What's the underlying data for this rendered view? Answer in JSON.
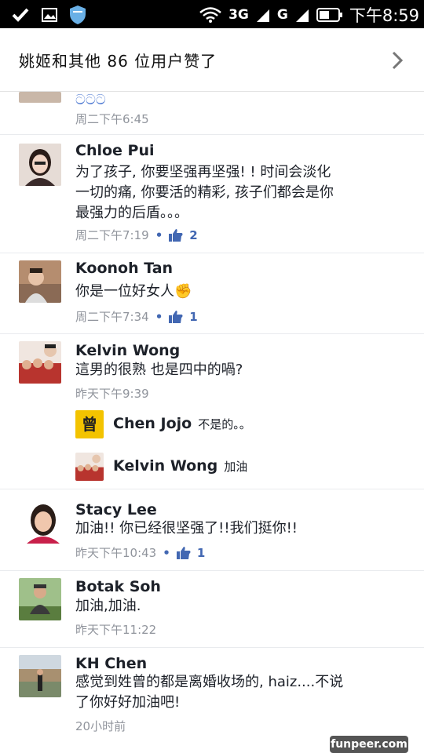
{
  "status_bar": {
    "network_3g": "3G",
    "network_g": "G",
    "time": "下午8:59"
  },
  "likes_header": {
    "text": "姚姬和其他 86 位用户赞了"
  },
  "partial_comment": {
    "emoji": "ටටට",
    "time": "周二下午6:45"
  },
  "comments": [
    {
      "name": "Chloe Pui",
      "lines": [
        "为了孩子, 你要坚强再坚强! ! 时间会淡化",
        "一切的痛, 你要活的精彩, 孩子们都会是你",
        "最强力的后盾。。。"
      ],
      "time": "周二下午7:19",
      "likes": "2"
    },
    {
      "name": "Koonoh Tan",
      "lines": [
        "你是一位好女人✊"
      ],
      "time": "周二下午7:34",
      "likes": "1"
    },
    {
      "name": "Kelvin Wong",
      "lines": [
        "這男的很熟 也是四中的喎?"
      ],
      "time": "昨天下午9:39"
    },
    {
      "name": "Stacy Lee",
      "lines": [
        "加油!! 你已经很坚强了!!我们挺你!!"
      ],
      "time": "昨天下午10:43",
      "likes": "1"
    },
    {
      "name": "Botak Soh",
      "lines": [
        "加油,加油."
      ],
      "time": "昨天下午11:22"
    },
    {
      "name": "KH Chen",
      "lines": [
        "感觉到姓曾的都是离婚收场的, haiz....不说",
        "了你好好加油吧!"
      ],
      "time": "20小时前"
    }
  ],
  "replies": [
    {
      "name": "Chen Jojo",
      "text": "不是的。。",
      "avatar_glyph": "曾"
    },
    {
      "name": "Kelvin Wong",
      "text": "加油"
    }
  ],
  "watermark": "funpeer.com",
  "colors": {
    "accent": "#4267b2",
    "meta": "#90949c",
    "statusbar": "#000000"
  }
}
